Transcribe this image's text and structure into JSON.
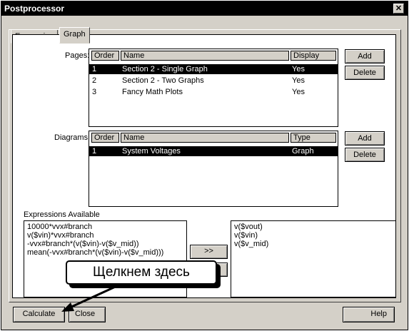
{
  "window": {
    "title": "Postprocessor",
    "close_glyph": "✕"
  },
  "tabs": [
    {
      "label": "Expression"
    },
    {
      "label": "Graph"
    }
  ],
  "pages": {
    "label": "Pages:",
    "columns": {
      "order": "Order",
      "name": "Name",
      "display": "Display"
    },
    "rows": [
      {
        "order": "1",
        "name": "Section 2 - Single Graph",
        "display": "Yes"
      },
      {
        "order": "2",
        "name": "Section 2 - Two Graphs",
        "display": "Yes"
      },
      {
        "order": "3",
        "name": "Fancy Math Plots",
        "display": "Yes"
      }
    ],
    "add_label": "Add",
    "delete_label": "Delete"
  },
  "diagrams": {
    "label": "Diagrams:",
    "columns": {
      "order": "Order",
      "name": "Name",
      "type": "Type"
    },
    "rows": [
      {
        "order": "1",
        "name": "System Voltages",
        "type": "Graph"
      }
    ],
    "add_label": "Add",
    "delete_label": "Delete"
  },
  "expressions": {
    "label": "Expressions Available",
    "available": [
      "10000*vvx#branch",
      "v($vin)*vvx#branch",
      "-vvx#branch*(v($vin)-v($v_mid))",
      "mean(-vvx#branch*(v($vin)-v($v_mid)))"
    ],
    "selected": [
      "v($vout)",
      "v($vin)",
      "v($v_mid)"
    ],
    "move_right_glyph": ">>"
  },
  "callout": {
    "text": "Щелкнем здесь"
  },
  "footer": {
    "calculate_label": "Calculate",
    "close_label": "Close",
    "help_label": "Help"
  }
}
